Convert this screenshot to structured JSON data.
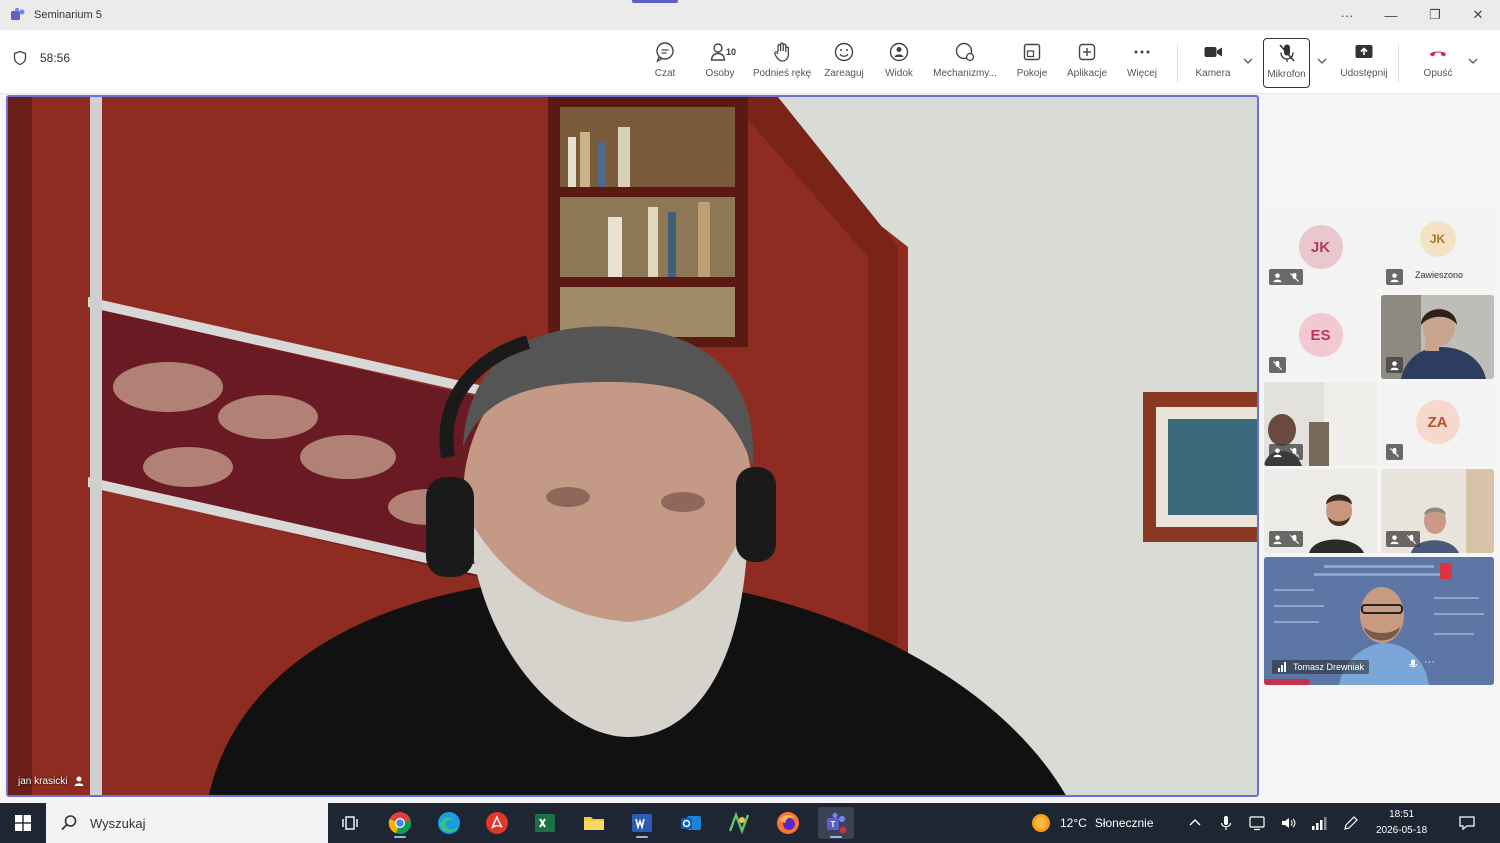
{
  "window": {
    "title": "Seminarium 5"
  },
  "meeting": {
    "timer": "58:56"
  },
  "toolbar": {
    "chat": "Czat",
    "people": "Osoby",
    "people_count": "10",
    "raise_hand": "Podnieś rękę",
    "react": "Zareaguj",
    "view": "Widok",
    "mechanisms": "Mechanizmy...",
    "rooms": "Pokoje",
    "apps": "Aplikacje",
    "more": "Więcej",
    "camera": "Kamera",
    "mic": "Mikrofon",
    "share": "Udostępnij",
    "leave": "Opuść"
  },
  "main_video": {
    "participant": "jan krasicki"
  },
  "participants": [
    {
      "initials": "JK",
      "color": "#e8c7cf",
      "text_color": "#b0405a"
    },
    {
      "initials": "JK",
      "status": "Zawieszono",
      "color": "#f3e3c4",
      "text_color": "#a57a28"
    },
    {
      "initials": "ES",
      "color": "#f2c9d3",
      "text_color": "#b8385a"
    },
    {
      "initials": "ZA",
      "color": "#f6d9cc",
      "text_color": "#b4502c"
    }
  ],
  "speaker_tile": {
    "name": "Tomasz Drewniak"
  },
  "taskbar": {
    "search": "Wyszukaj",
    "weather_temp": "12°C",
    "weather_desc": "Słonecznie",
    "time": "18:51",
    "date": "2026-05-18"
  }
}
